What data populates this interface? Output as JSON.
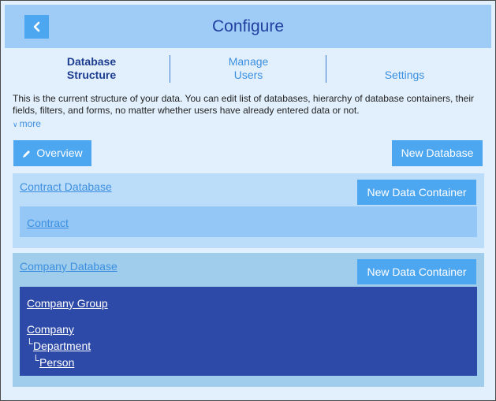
{
  "header": {
    "title": "Configure",
    "back_icon": "chevron-left-icon"
  },
  "tabs": [
    {
      "label_line1": "Database",
      "label_line2": "Structure",
      "active": true
    },
    {
      "label_line1": "Manage",
      "label_line2": "Users",
      "active": false
    },
    {
      "label_line1": "",
      "label_line2": "Settings",
      "active": false
    }
  ],
  "description": {
    "text": "This is the current structure of your data. You can edit list of databases, hierarchy of database containers, their fields, filters, and forms, no matter whether users have already entered data or not.",
    "more_label": "more"
  },
  "toolbar": {
    "overview_label": "Overview",
    "new_database_label": "New Database"
  },
  "databases": [
    {
      "name": "Contract Database",
      "new_container_label": "New Data Container",
      "containers": [
        "Contract"
      ]
    },
    {
      "name": "Company Database",
      "new_container_label": "New Data Container",
      "group": "Company Group",
      "tree": [
        "Company",
        "Department",
        "Person"
      ],
      "branch_glyph": "└"
    }
  ],
  "colors": {
    "accent": "#4da6f0",
    "header_bg": "#9fccf6",
    "selected_container_bg": "#2e4aa8",
    "title_text": "#2140a0"
  }
}
